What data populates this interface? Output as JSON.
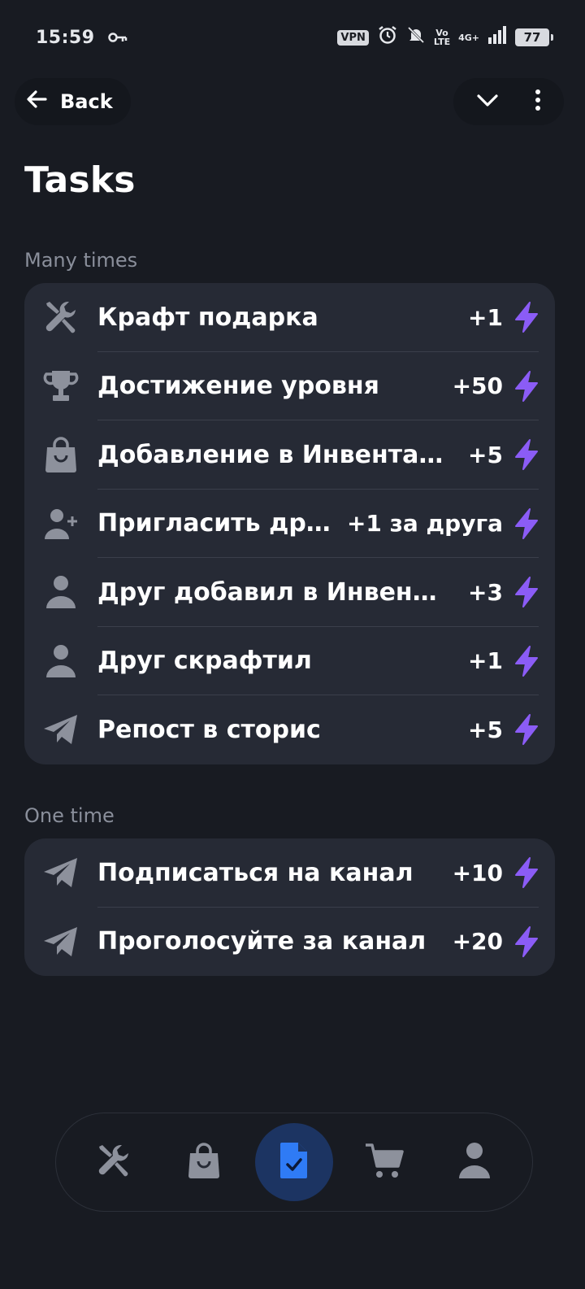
{
  "status_bar": {
    "time": "15:59",
    "vpn": "VPN",
    "volte_top": "Vo",
    "volte_bottom": "LTE",
    "network": "4G+",
    "battery": "77",
    "icons": [
      "key-icon",
      "alarm-icon",
      "bell-off-icon",
      "signal-icon"
    ]
  },
  "header": {
    "back_label": "Back",
    "icons": [
      "arrow-left-icon",
      "chevron-down-icon",
      "more-vertical-icon"
    ]
  },
  "page_title": "Tasks",
  "sections": [
    {
      "label": "Many times",
      "items": [
        {
          "icon": "tools-icon",
          "label": "Крафт подарка",
          "reward": "+1"
        },
        {
          "icon": "trophy-icon",
          "label": "Достижение уровня",
          "reward": "+50"
        },
        {
          "icon": "bag-icon",
          "label": "Добавление в Инвента…",
          "reward": "+5"
        },
        {
          "icon": "user-plus-icon",
          "label": "Пригласить др…",
          "reward": "+1 за друга"
        },
        {
          "icon": "user-icon",
          "label": "Друг добавил в Инвен…",
          "reward": "+3"
        },
        {
          "icon": "user-icon",
          "label": "Друг скрафтил",
          "reward": "+1"
        },
        {
          "icon": "telegram-icon",
          "label": "Репост в сторис",
          "reward": "+5"
        }
      ]
    },
    {
      "label": "One time",
      "items": [
        {
          "icon": "telegram-icon",
          "label": "Подписаться на канал",
          "reward": "+10"
        },
        {
          "icon": "telegram-icon",
          "label": "Проголосуйте за канал",
          "reward": "+20"
        }
      ]
    }
  ],
  "reward_icon": "lightning-icon",
  "bottom_nav": {
    "items": [
      {
        "icon": "tools-icon",
        "active": false
      },
      {
        "icon": "bag-icon",
        "active": false
      },
      {
        "icon": "task-document-icon",
        "active": true
      },
      {
        "icon": "cart-icon",
        "active": false
      },
      {
        "icon": "profile-icon",
        "active": false
      }
    ]
  },
  "colors": {
    "background": "#181b22",
    "card": "#262a35",
    "accent_purple": "#8b5cf6",
    "active_nav": "#1c3462",
    "active_icon": "#2f7bf5",
    "muted_text": "#8a8f9b",
    "icon_gray": "#8d919c"
  }
}
